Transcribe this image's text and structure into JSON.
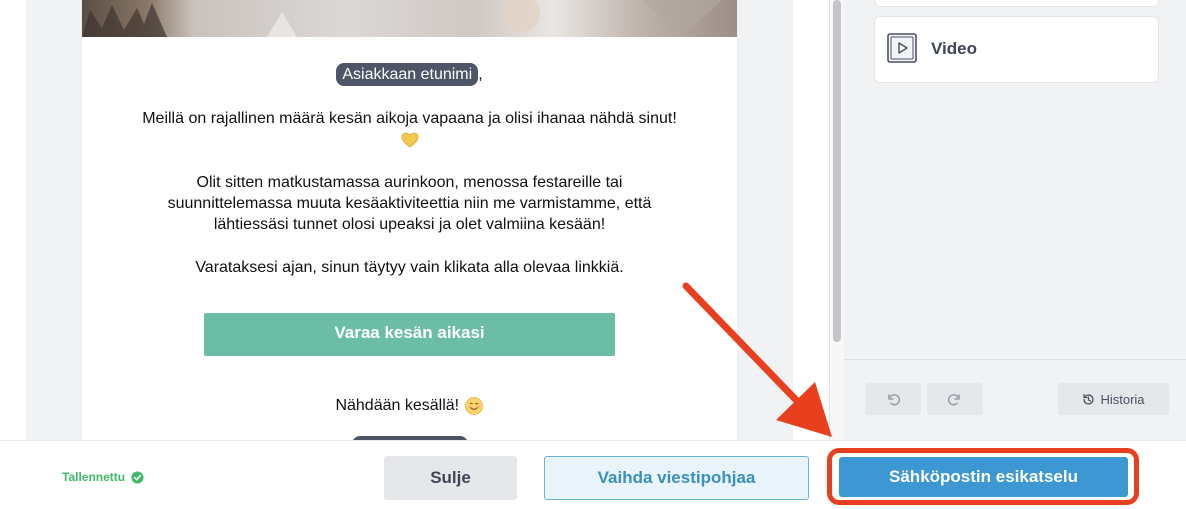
{
  "email": {
    "greeting_tag": "Asiakkaan etunimi",
    "greeting_suffix": ",",
    "paragraph_1": "Meillä on rajallinen määrä kesän aikoja vapaana ja olisi ihanaa nähdä sinut!",
    "paragraph_2": "Olit sitten matkustamassa aurinkoon, menossa festareille tai suunnittelemassa muuta kesäaktiviteettia niin me varmistamme, että lähtiessäsi tunnet olosi upeaksi ja olet valmiina kesään!",
    "paragraph_3": "Varataksesi ajan, sinun täytyy vain klikata alla olevaa linkkiä.",
    "cta_label": "Varaa kesän aikasi",
    "paragraph_4": "Nähdään kesällä!"
  },
  "sidebar": {
    "video_block_label": "Video",
    "history_label": "Historia"
  },
  "footer": {
    "saved_status": "Tallennettu",
    "close_label": "Sulje",
    "change_template_label": "Vaihda viestipohjaa",
    "preview_label": "Sähköpostin esikatselu"
  },
  "colors": {
    "cta": "#6bbda5",
    "merge_tag": "#4d5566",
    "preview_button": "#3d97d3",
    "highlight": "#e8401f",
    "saved_green": "#41b86a"
  }
}
